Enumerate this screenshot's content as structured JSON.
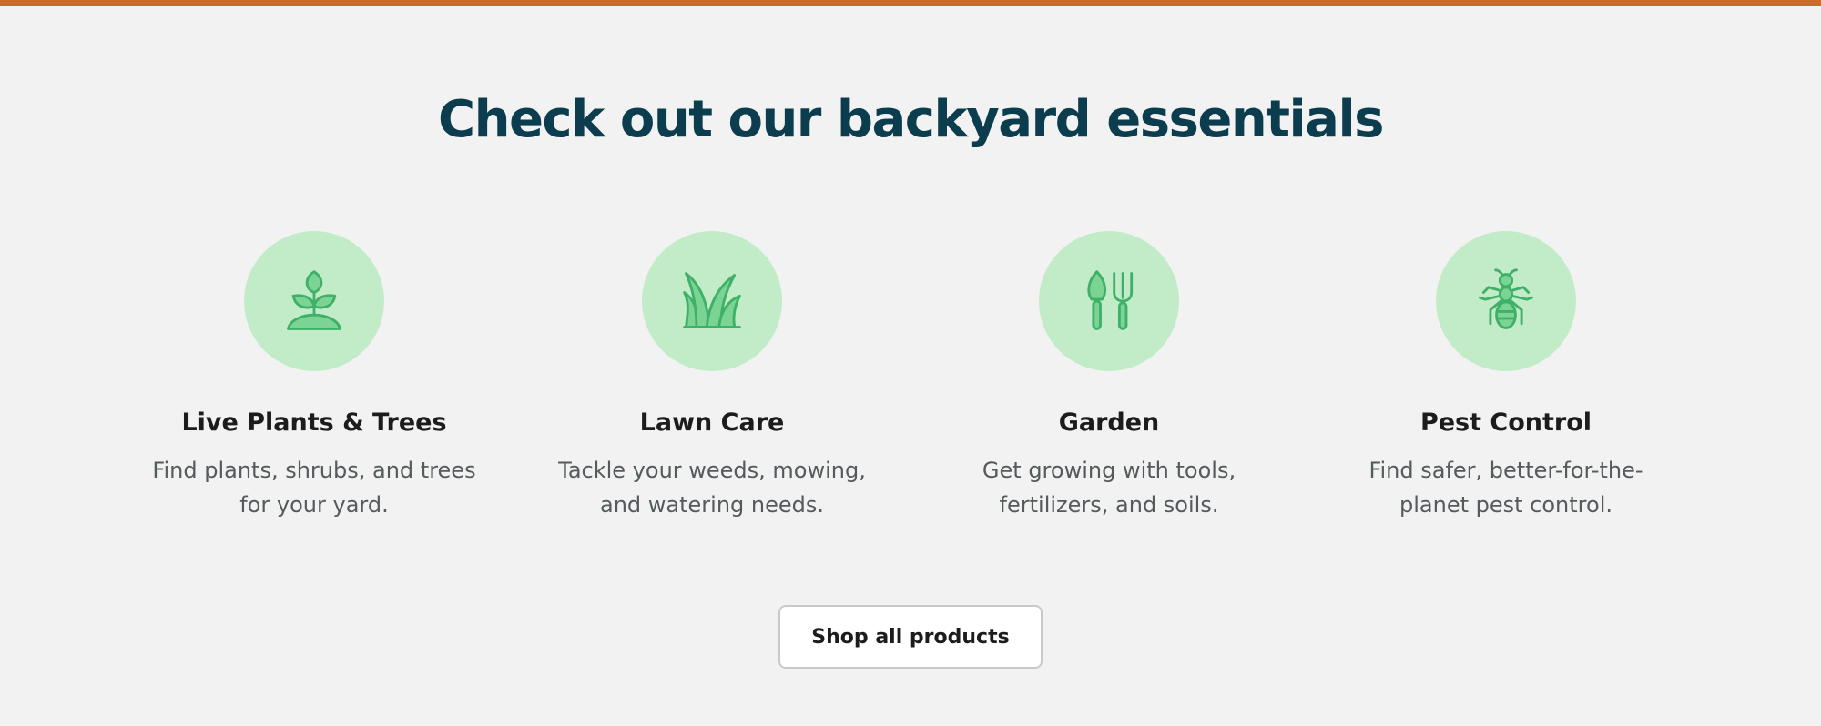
{
  "section": {
    "title": "Check out our backyard essentials"
  },
  "categories": [
    {
      "title": "Live Plants & Trees",
      "description": "Find plants, shrubs, and trees for your yard.",
      "icon": "sprout-icon"
    },
    {
      "title": "Lawn Care",
      "description": "Tackle your weeds, mowing, and watering needs.",
      "icon": "grass-icon"
    },
    {
      "title": "Garden",
      "description": "Get growing with tools, fertilizers, and soils.",
      "icon": "trowel-fork-icon"
    },
    {
      "title": "Pest Control",
      "description": "Find safer, better-for-the-planet pest control.",
      "icon": "ant-icon"
    }
  ],
  "shop_button": {
    "label": "Shop all products"
  },
  "colors": {
    "accent_bar": "#d0692f",
    "title": "#0b3d4e",
    "icon_circle": "#c2ebc8",
    "icon_stroke": "#3fb068",
    "icon_fill": "#7bd494",
    "background": "#f1f2f1"
  }
}
